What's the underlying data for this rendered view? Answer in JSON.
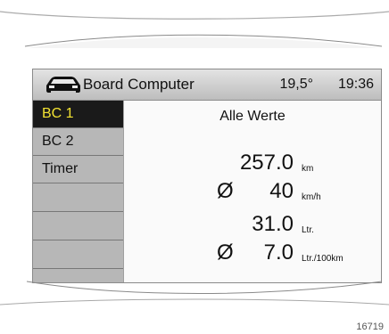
{
  "header": {
    "title": "Board Computer",
    "temperature": "19,5°",
    "time": "19:36",
    "icon": "car-icon"
  },
  "sidebar": {
    "items": [
      {
        "label": "BC 1",
        "active": true
      },
      {
        "label": "BC 2",
        "active": false
      },
      {
        "label": "Timer",
        "active": false
      },
      {
        "label": "",
        "active": false
      },
      {
        "label": "",
        "active": false
      },
      {
        "label": "",
        "active": false
      }
    ]
  },
  "main": {
    "section_title": "Alle Werte",
    "values": [
      {
        "symbol": "",
        "value": "257.0",
        "unit": "km"
      },
      {
        "symbol": "Ø",
        "value": "40",
        "unit": "km/h"
      },
      {
        "symbol": "",
        "value": "31.0",
        "unit": "Ltr."
      },
      {
        "symbol": "Ø",
        "value": "7.0",
        "unit": "Ltr./100km"
      }
    ]
  },
  "footer": {
    "code": "16719"
  },
  "colors": {
    "active_bg": "#1a1a1a",
    "active_text": "#f3e332",
    "header_bg": "#d0d0d0",
    "sidebar_bg": "#b7b7b7",
    "panel_bg": "#fafafa"
  }
}
